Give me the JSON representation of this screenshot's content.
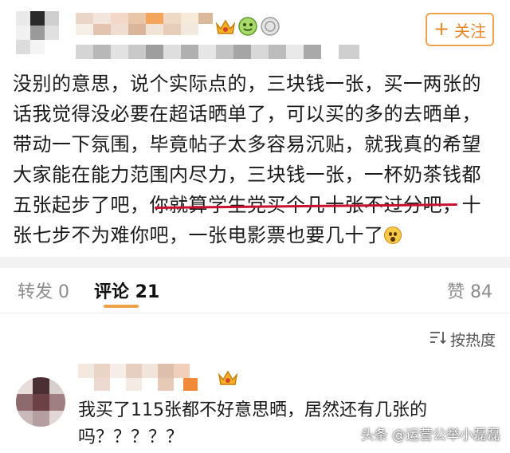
{
  "header": {
    "follow_button": {
      "icon": "plus-icon",
      "label": "关注"
    },
    "badges": [
      "crown-icon",
      "green-face-badge-icon",
      "silver-medal-icon"
    ]
  },
  "post": {
    "text_before": "没别的意思，说个实际点的，三块钱一张，买一两张的话我觉得没必要在超话晒单了，可以买的多的去晒单，带动一下氛围，毕竟帖子太多容易沉贴，就我真的希望大家能在能力范围内尽力，三块钱一张，一杯奶茶钱都五张起步了吧，",
    "text_highlight": "你就算学生党买个几十张不过分吧",
    "text_after": "，十张七步不为难你吧，一张电影票也要几十了",
    "trailing_emoji": "shocked-face-emoji",
    "highlight_color": "#c8102e"
  },
  "tabs": {
    "repost": "转发 0",
    "comment": "评论 21",
    "like": "赞 84",
    "active_accent": "#f0a14b"
  },
  "sort": {
    "icon": "sort-lines-icon",
    "label": "按热度"
  },
  "comment": {
    "badge": "crown-icon",
    "text": "我买了115张都不好意思晒，居然还有几张的吗？？？？？"
  },
  "watermark": {
    "label": "头条 @运营公举小磊磊"
  },
  "colors": {
    "accent": "#e8862a",
    "text": "#1a1a1a",
    "muted": "#8c8c8c",
    "band": "#f2f2f2"
  }
}
